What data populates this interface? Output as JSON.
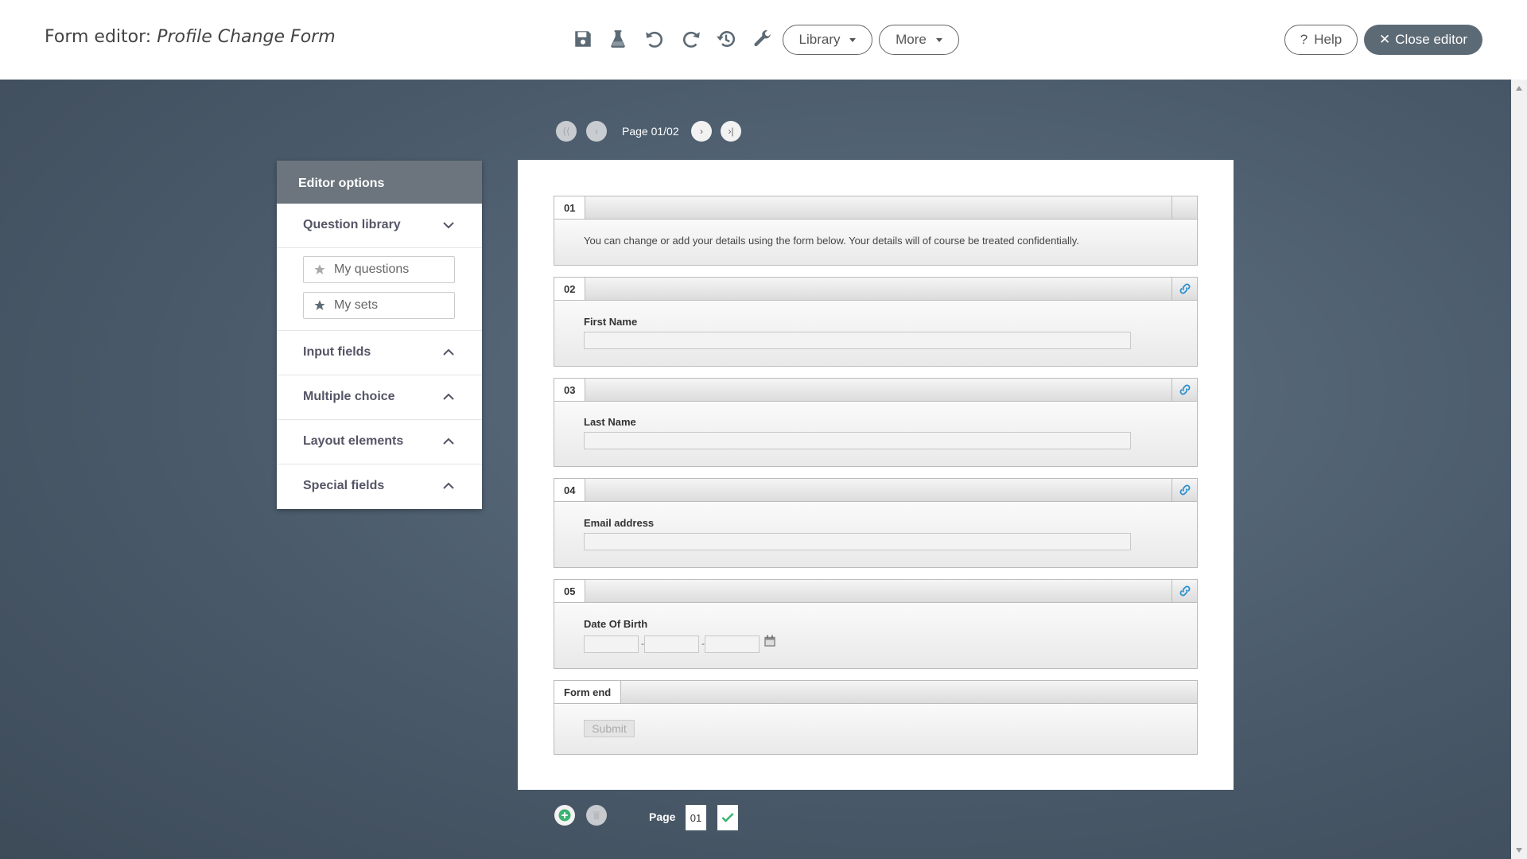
{
  "header": {
    "title_prefix": "Form editor: ",
    "title_form": "Profile Change Form",
    "library_label": "Library",
    "more_label": "More",
    "help_label": "Help",
    "close_label": "Close editor",
    "toolbar_icons": [
      "save-icon",
      "flask-icon",
      "undo-icon",
      "redo-icon",
      "history-icon",
      "wrench-icon"
    ]
  },
  "pagination": {
    "label": "Page 01/02"
  },
  "editor_options": {
    "title": "Editor options",
    "sections": [
      {
        "label": "Question library",
        "state": "expanded"
      },
      {
        "label": "Input fields",
        "state": "collapsed"
      },
      {
        "label": "Multiple choice",
        "state": "collapsed"
      },
      {
        "label": "Layout elements",
        "state": "collapsed"
      },
      {
        "label": "Special fields",
        "state": "collapsed"
      }
    ],
    "library_items": [
      "My questions",
      "My sets"
    ]
  },
  "form": {
    "questions": [
      {
        "number": "01",
        "text": "You can change or add your details using the form below. Your details will of course be treated confidentially."
      },
      {
        "number": "02",
        "label": "First Name"
      },
      {
        "number": "03",
        "label": "Last Name"
      },
      {
        "number": "04",
        "label": "Email address"
      },
      {
        "number": "05",
        "label": "Date Of Birth",
        "date_separator": "-"
      }
    ],
    "end": {
      "label": "Form end",
      "submit": "Submit"
    }
  },
  "footer": {
    "page_label": "Page",
    "page_number": "01"
  },
  "colors": {
    "accent_dark": "#5c6a75",
    "panel_header": "#6c757d",
    "add_green": "#3cb371",
    "link_blue": "#2a8fd0"
  }
}
